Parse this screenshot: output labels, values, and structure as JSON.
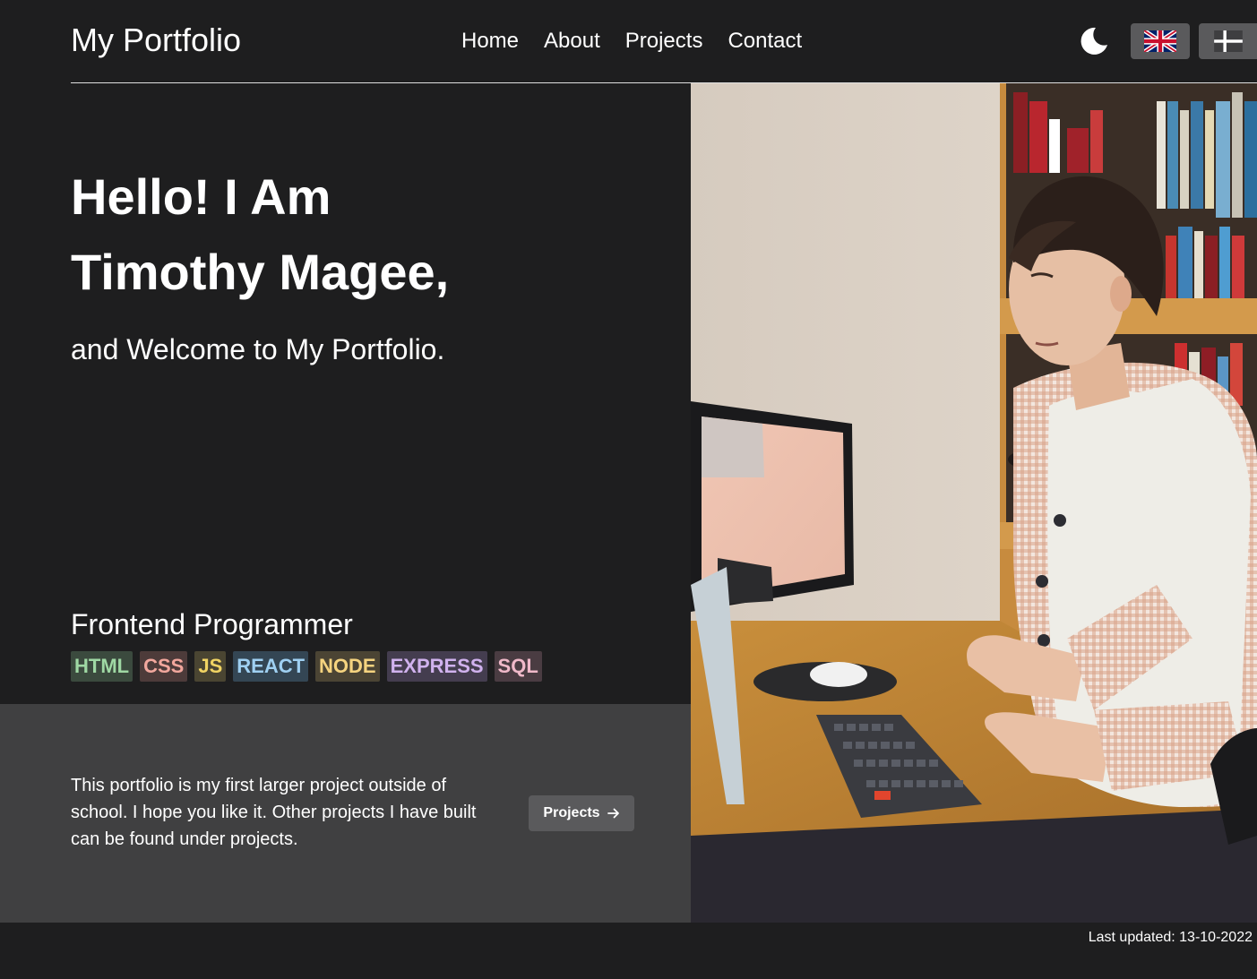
{
  "header": {
    "brand": "My Portfolio",
    "nav": [
      {
        "label": "Home"
      },
      {
        "label": "About"
      },
      {
        "label": "Projects"
      },
      {
        "label": "Contact"
      }
    ],
    "theme_toggle_icon": "moon-icon",
    "languages": [
      {
        "icon": "uk-flag-icon"
      },
      {
        "icon": "danish-flag-icon"
      }
    ]
  },
  "hero": {
    "title_line1": "Hello! I Am",
    "title_line2": "Timothy Magee,",
    "subtitle": "and Welcome to My Portfolio.",
    "role": "Frontend Programmer",
    "tags": [
      {
        "label": "HTML",
        "color": "#9fd8a4",
        "bg": "#3b4a3e"
      },
      {
        "label": "CSS",
        "color": "#f2a79d",
        "bg": "#4d3b3a"
      },
      {
        "label": "JS",
        "color": "#f1d463",
        "bg": "#4a4532"
      },
      {
        "label": "REACT",
        "color": "#9fd0f2",
        "bg": "#344654"
      },
      {
        "label": "NODE",
        "color": "#f5d37f",
        "bg": "#4b4434"
      },
      {
        "label": "EXPRESS",
        "color": "#d0b2ee",
        "bg": "#443d4f"
      },
      {
        "label": "SQL",
        "color": "#f0b9c9",
        "bg": "#4a3c42"
      }
    ]
  },
  "intro": {
    "text": "This portfolio is my first larger project outside of school. I hope you like it. Other projects I have built can be found under projects.",
    "button_label": "Projects",
    "button_icon": "arrow-right-icon"
  },
  "photo": {
    "subject": "man-typing-at-desk-photo"
  },
  "footer": {
    "last_updated": "Last updated: 13-10-2022"
  },
  "colors": {
    "background": "#1e1e1f",
    "panel": "#404041",
    "button": "#5a5a5c"
  }
}
